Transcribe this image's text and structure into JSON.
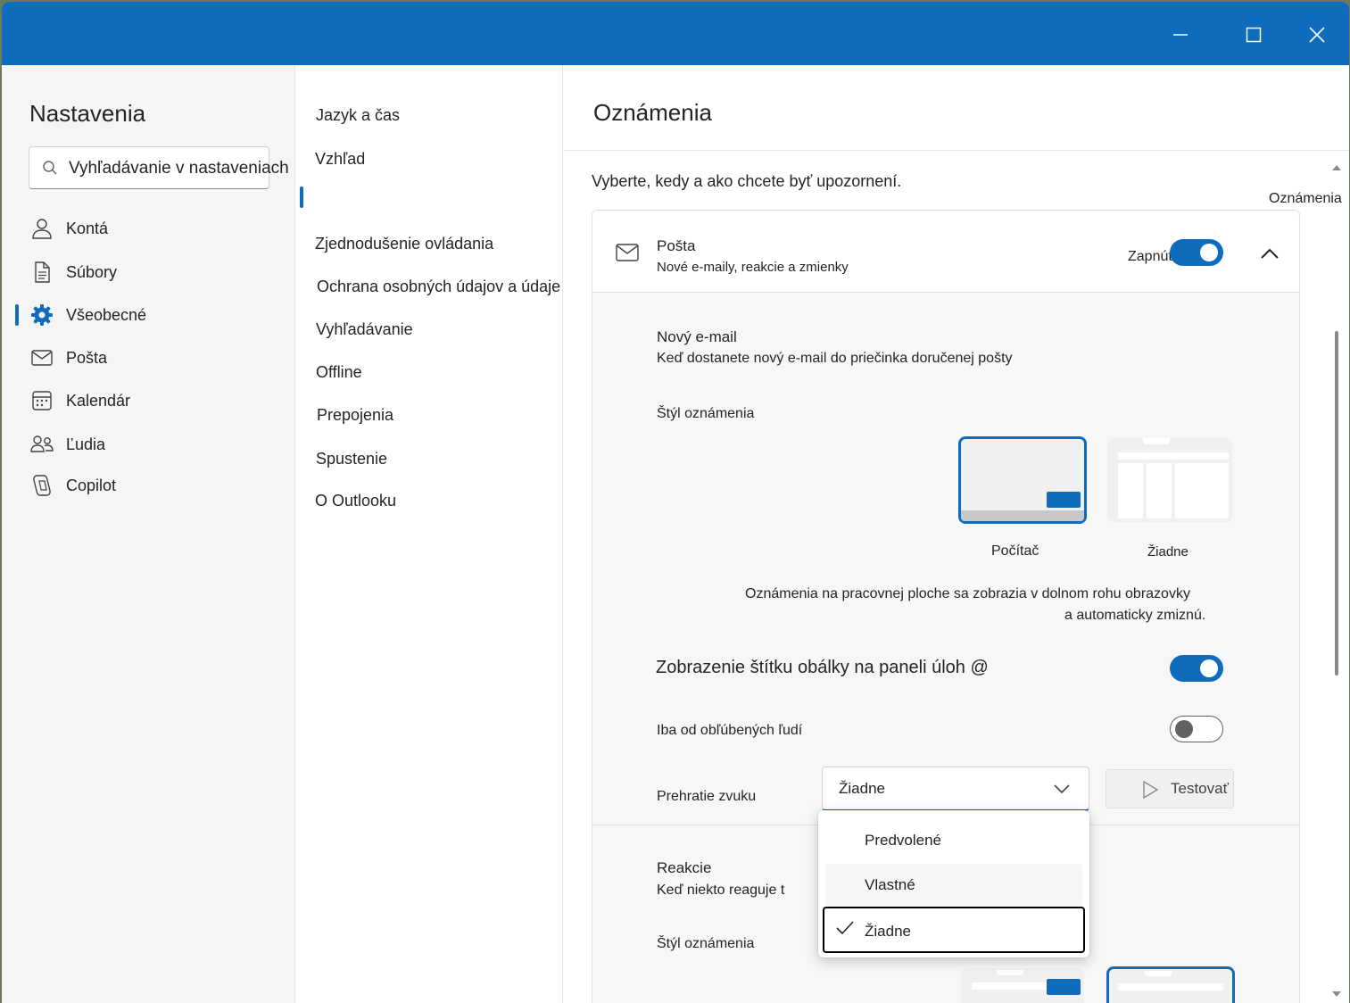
{
  "window": {
    "minimize_icon": "minimize-icon",
    "maximize_icon": "maximize-icon",
    "close_icon": "close-icon",
    "accent": "#0f6cbd"
  },
  "sidebar": {
    "title": "Nastavenia",
    "search_text": "Vyhľadávanie v nastaveniach",
    "items": [
      {
        "label": "Kontá",
        "icon": "person-icon"
      },
      {
        "label": "Súbory",
        "icon": "document-icon"
      },
      {
        "label": "Všeobecné",
        "icon": "gear-icon",
        "active": true
      },
      {
        "label": "Pošta",
        "icon": "mail-icon"
      },
      {
        "label": "Kalendár",
        "icon": "calendar-icon"
      },
      {
        "label": "Ľudia",
        "icon": "people-icon"
      },
      {
        "label": "Copilot",
        "icon": "copilot-icon"
      }
    ]
  },
  "subnav": {
    "items": [
      {
        "label": "Jazyk a čas"
      },
      {
        "label": "Vzhľad"
      },
      {
        "label": "Zjednodušenie ovládania"
      },
      {
        "label": "Ochrana osobných údajov a údaje"
      },
      {
        "label": "Vyhľadávanie"
      },
      {
        "label": "Offline"
      },
      {
        "label": "Prepojenia"
      },
      {
        "label": "Spustenie"
      },
      {
        "label": "O Outlooku"
      }
    ]
  },
  "pane": {
    "title": "Oznámenia",
    "description": "Vyberte, kedy a ako chcete byť upozornení.",
    "floating_label": "Oznámenia",
    "mail_card": {
      "title": "Pošta",
      "subtitle": "Nové e-maily, reakcie a zmienky",
      "toggle_label": "Zapnúť",
      "toggle_on": true,
      "new_email_title": "Nový e-mail",
      "new_email_desc": "Keď dostanete nový e-mail do priečinka doručenej pošty",
      "style_label": "Štýl oznámenia",
      "style_options": [
        {
          "label": "Počítač",
          "selected": true
        },
        {
          "label": "Žiadne",
          "selected": false
        }
      ],
      "style_note_line1": "Oznámenia na pracovnej ploche sa zobrazia v dolnom rohu obrazovky",
      "style_note_line2": "a automaticky zmiznú.",
      "badge_label": "Zobrazenie štítku obálky na paneli úloh @",
      "badge_on": true,
      "favorites_label": "Iba od obľúbených ľudí",
      "favorites_on": false,
      "sound_label": "Prehratie zvuku",
      "sound_value": "Žiadne",
      "test_label": "Testovať",
      "reactions_title": "Reakcie",
      "reactions_desc": "Keď niekto reaguje t",
      "reactions_style_label": "Štýl oznámenia"
    },
    "sound_options": [
      {
        "label": "Predvolené",
        "selected": false
      },
      {
        "label": "Vlastné",
        "selected": false
      },
      {
        "label": "Žiadne",
        "selected": true
      }
    ]
  }
}
